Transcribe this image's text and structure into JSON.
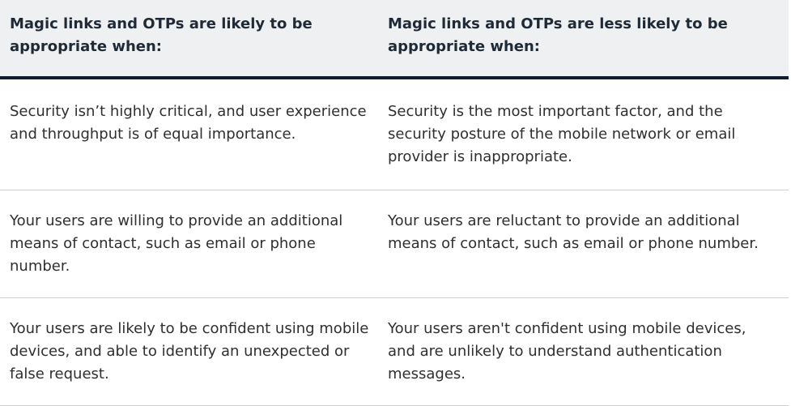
{
  "table": {
    "headers": [
      "Magic links and OTPs are likely to be appropriate when:",
      "Magic links and OTPs are less likely to be appropriate when:"
    ],
    "rows": [
      {
        "appropriate": "Security isn’t highly critical, and user experience and throughput is of equal importance.",
        "less_appropriate": "Security is the most important factor, and the security posture of the mobile network or email provider is inappropriate."
      },
      {
        "appropriate": "Your users are willing to provide an additional means of contact, such as email or phone number.",
        "less_appropriate": "Your users are reluctant to provide an additional means of contact, such as email or phone number."
      },
      {
        "appropriate": "Your users are likely to be confident using mobile devices, and able to identify an unexpected or false request.",
        "less_appropriate": "Your users aren't confident using mobile devices, and are unlikely to understand authentication messages."
      }
    ]
  },
  "colors": {
    "header_bg": "#eef0f2",
    "header_rule": "#111c33",
    "row_rule": "#cfcfcf"
  }
}
